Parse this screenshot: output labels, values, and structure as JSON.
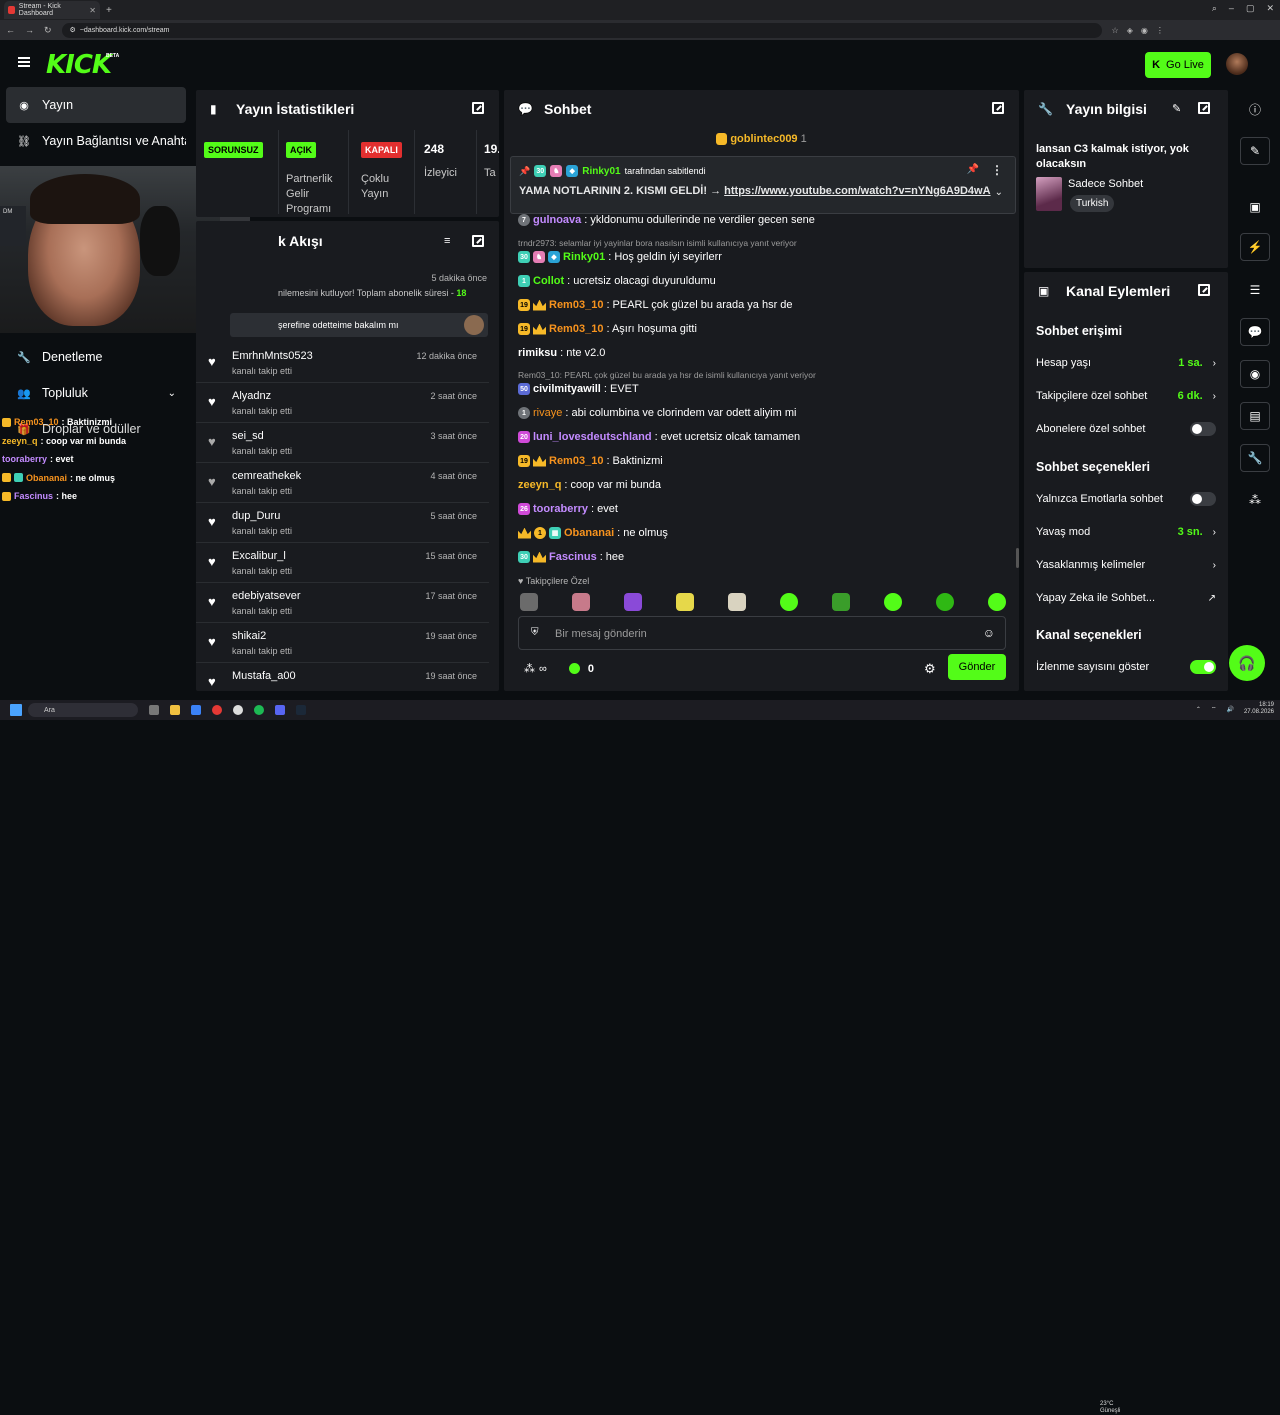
{
  "browser": {
    "tab_title": "Stream - Kick Dashboard",
    "url": "~dashboard.kick.com/stream"
  },
  "header": {
    "logo": "KICK",
    "logo_badge": "BETA",
    "go_live": "Go Live"
  },
  "sidebar": {
    "items": [
      {
        "label": "Yayın",
        "icon": "play-circle-icon"
      },
      {
        "label": "Yayın Bağlantısı ve Anahtarı",
        "icon": "link-icon"
      },
      {
        "label": "Denetleme",
        "icon": "wrench-icon"
      },
      {
        "label": "Topluluk",
        "icon": "users-icon"
      },
      {
        "label": "Droplar ve ödüller",
        "icon": "gift-icon"
      }
    ],
    "webcam_caption": "DM"
  },
  "overlay_chat": [
    {
      "user": "Rem03_10",
      "text": " : Baktinizmi",
      "color": "#f7931e"
    },
    {
      "user": "zeeyn_q",
      "text": " : coop var mi bunda",
      "color": "#f6b928"
    },
    {
      "user": "tooraberry",
      "text": " : evet",
      "color": "#c38bff"
    },
    {
      "user": "Obananai",
      "text": " : ne olmuş",
      "color": "#f7931e"
    },
    {
      "user": "Fascinus",
      "text": " : hee",
      "color": "#c38bff"
    }
  ],
  "stats": {
    "title": "Yayın İstatistikleri",
    "health": "SORUNSUZ",
    "partner_tag": "AÇIK",
    "partner_label": "Partnerlik Gelir Programı",
    "multi_tag": "KAPALI",
    "multi_label": "Çoklu Yayın",
    "viewers": "248",
    "viewers_label": "İzleyici",
    "followers_partial": "19.",
    "followers_label_partial": "Ta"
  },
  "activity": {
    "title": "k Akışı",
    "top_time": "5 dakika önce",
    "top_text": "nilemesini kutluyor! Toplam abonelik süresi - ",
    "top_months": "18",
    "top_msg": "şerefine odetteime bakalım mı",
    "items": [
      {
        "name": "EmrhnMnts0523",
        "sub": "kanalı takip etti",
        "time": "12 dakika önce"
      },
      {
        "name": "Alyadnz",
        "sub": "kanalı takip etti",
        "time": "2 saat önce"
      },
      {
        "name": "sei_sd",
        "sub": "kanalı takip etti",
        "time": "3 saat önce"
      },
      {
        "name": "cemreathekek",
        "sub": "kanalı takip etti",
        "time": "4 saat önce"
      },
      {
        "name": "dup_Duru",
        "sub": "kanalı takip etti",
        "time": "5 saat önce"
      },
      {
        "name": "Excalibur_l",
        "sub": "kanalı takip etti",
        "time": "15 saat önce"
      },
      {
        "name": "edebiyatsever",
        "sub": "kanalı takip etti",
        "time": "17 saat önce"
      },
      {
        "name": "shikai2",
        "sub": "kanalı takip etti",
        "time": "19 saat önce"
      },
      {
        "name": "Mustafa_a00",
        "sub": "kanalı takip etti",
        "time": "19 saat önce"
      }
    ]
  },
  "chat": {
    "title": "Sohbet",
    "top_gifter": "goblintec009",
    "top_gifter_count": "1",
    "pinned_by": "Rinky01",
    "pinned_suffix": "tarafından sabitlendi",
    "pinned_text": "YAMA NOTLARININ 2. KISMI GELDİ! →",
    "pinned_link": "https://www.youtube.com/watch?v=nYNg6A9D4wA",
    "messages": [
      {
        "badge": "7",
        "bcolor": "#6f7378",
        "user": "gulnoava",
        "ucolor": "#c38bff",
        "text": ": ykldonumu odullerinde ne verdiler gecen sene"
      },
      {
        "reply": "trndr2973: selamlar iyi yayinlar bora nasılsın isimli kullanıcıya yanıt veriyor"
      },
      {
        "badge": "30",
        "bcolor": "#3ecfb5",
        "user": "Rinky01",
        "ucolor": "#53fc18",
        "text": ": Hoş geldin iyi seyirlerr"
      },
      {
        "badge": "1",
        "bcolor": "#3ecfb5",
        "user": "Collot",
        "ucolor": "#53fc18",
        "text": ": ucretsiz olacagi duyuruldumu"
      },
      {
        "badge": "19",
        "bcolor": "#f6b928",
        "user": "Rem03_10",
        "ucolor": "#f7931e",
        "text": ": PEARL çok güzel bu arada ya hsr de"
      },
      {
        "badge": "19",
        "bcolor": "#f6b928",
        "user": "Rem03_10",
        "ucolor": "#f7931e",
        "text": ": Aşırı hoşuma gitti"
      },
      {
        "user": "rimiksu",
        "ucolor": "#ffffff",
        "text": ": nte v2.0"
      },
      {
        "reply": "Rem03_10: PEARL çok güzel bu arada ya hsr de isimli kullanıcıya yanıt veriyor"
      },
      {
        "badge": "50",
        "bcolor": "#5b6bd6",
        "user": "civilmityawill",
        "ucolor": "#ffffff",
        "text": ": EVET"
      },
      {
        "badge": "1",
        "bcolor": "#6f7378",
        "user": "rivaye",
        "ucolor": "#f7931e",
        "text": ": abi columbina ve clorindem var odett aliyim mi"
      },
      {
        "badge": "20",
        "bcolor": "#d04ad8",
        "user": "luni_lovesdeutschland",
        "ucolor": "#c38bff",
        "text": ": evet ucretsiz olcak tamamen"
      },
      {
        "badge": "19",
        "bcolor": "#f6b928",
        "user": "Rem03_10",
        "ucolor": "#f7931e",
        "text": ": Baktinizmi"
      },
      {
        "user": "zeeyn_q",
        "ucolor": "#f6b928",
        "text": ": coop var mi bunda"
      },
      {
        "badge": "26",
        "bcolor": "#d04ad8",
        "user": "tooraberry",
        "ucolor": "#c38bff",
        "text": ": evet"
      },
      {
        "badge": "1",
        "bcolor": "#f6b928",
        "user": "Obananai",
        "ucolor": "#f7931e",
        "text": ": ne olmuş"
      },
      {
        "badge": "30",
        "bcolor": "#3ecfb5",
        "user": "Fascinus",
        "ucolor": "#c38bff",
        "text": ": hee"
      }
    ],
    "mode_label": "Takipçilere Özel",
    "input_placeholder": "Bir mesaj gönderin",
    "viewer_count": "0",
    "send_label": "Gönder"
  },
  "stream_info": {
    "title_label": "Yayın bilgisi",
    "stream_title": "lansan C3 kalmak istiyor, yok olacaksın",
    "category": "Sadece Sohbet",
    "language": "Turkish"
  },
  "channel_actions": {
    "title": "Kanal Eylemleri",
    "chat_access_head": "Sohbet erişimi",
    "account_age_label": "Hesap yaşı",
    "account_age_value": "1 sa.",
    "followers_only_label": "Takipçilere özel sohbet",
    "followers_only_value": "6 dk.",
    "subs_only_label": "Abonelere özel sohbet",
    "chat_options_head": "Sohbet seçenekleri",
    "emote_only_label": "Yalnızca Emotlarla sohbet",
    "slow_mode_label": "Yavaş mod",
    "slow_mode_value": "3 sn.",
    "banned_words_label": "Yasaklanmış kelimeler",
    "ai_label": "Yapay Zeka ile Sohbet...",
    "channel_options_head": "Kanal seçenekleri",
    "show_viewers_label": "İzlenme sayısını göster"
  },
  "taskbar": {
    "search_label": "Ara",
    "weather_temp": "23°C",
    "weather_desc": "Güneşli",
    "time": "18:19",
    "date": "27.08.2026"
  },
  "colors": {
    "accent": "#53fc18",
    "panel": "#191b1f",
    "bg": "#0b0e11"
  }
}
